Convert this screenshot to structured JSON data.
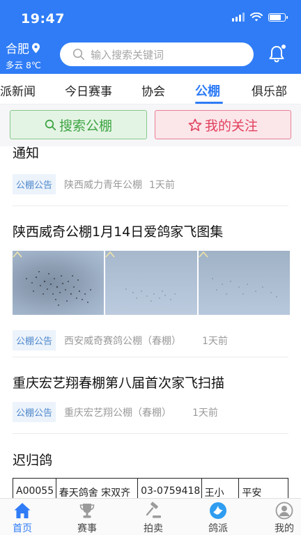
{
  "status_bar": {
    "time": "19:47"
  },
  "header": {
    "city": "合肥",
    "weather": "多云 8℃",
    "search_placeholder": "输入搜索关键词"
  },
  "tabs": [
    {
      "label": "派新闻"
    },
    {
      "label": "今日赛事"
    },
    {
      "label": "协会"
    },
    {
      "label": "公棚",
      "active": true
    },
    {
      "label": "俱乐部"
    }
  ],
  "actions": {
    "search_label": "搜索公棚",
    "follow_label": "我的关注"
  },
  "feed": [
    {
      "title": "通知",
      "tag": "公棚公告",
      "source": "陕西威力青年公棚",
      "time": "1天前"
    },
    {
      "title": "陕西威奇公棚1月14日爱鸽家飞图集",
      "tag": "公棚公告",
      "source": "西安威奇赛鸽公棚（春棚）",
      "time": "1天前",
      "has_photos": true
    },
    {
      "title": "重庆宏艺翔春棚第八届首次家飞扫描",
      "tag": "公棚公告",
      "source": "重庆宏艺翔公棚（春棚）",
      "time": "1天前"
    },
    {
      "title": "迟归鸽",
      "table_cells": [
        "A00055",
        "春天鸽舍 宋双齐",
        "03-0759418",
        "王小",
        "平安"
      ]
    }
  ],
  "bottom_nav": [
    {
      "label": "首页",
      "icon": "home-icon",
      "active": true
    },
    {
      "label": "赛事",
      "icon": "trophy-icon"
    },
    {
      "label": "拍卖",
      "icon": "gavel-icon"
    },
    {
      "label": "鸽派",
      "icon": "pigeon-icon"
    },
    {
      "label": "我的",
      "icon": "profile-icon"
    }
  ],
  "colors": {
    "brand_blue": "#2f7cf6",
    "search_green": "#3ea544",
    "follow_red": "#e1415d",
    "tag_blue": "#4e87cc"
  }
}
